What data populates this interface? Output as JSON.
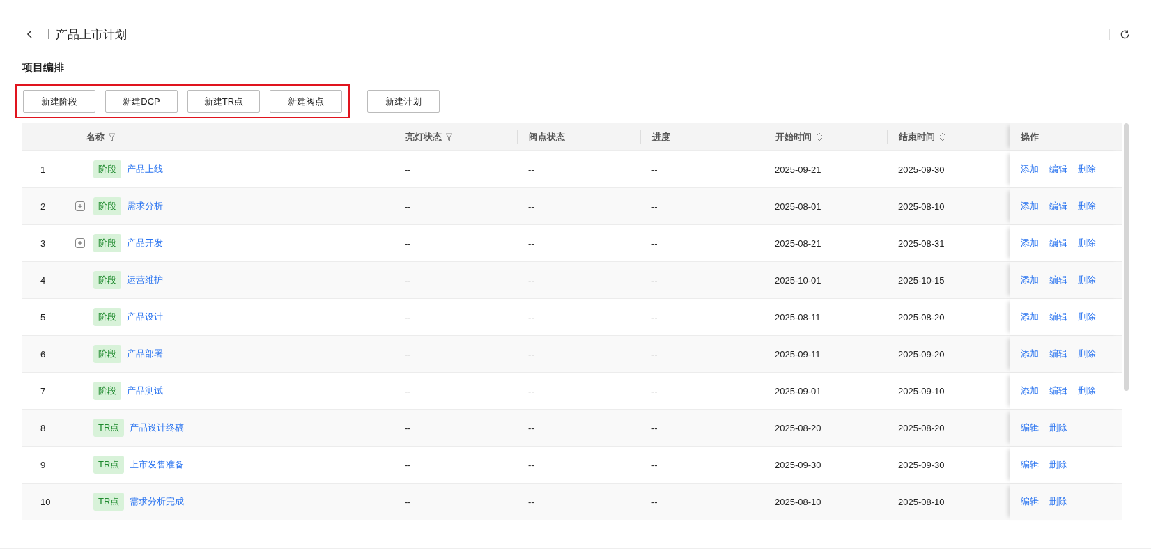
{
  "header": {
    "title": "产品上市计划"
  },
  "section_title": "项目编排",
  "button_groups": [
    {
      "highlighted": true,
      "buttons": [
        "新建阶段",
        "新建DCP",
        "新建TR点",
        "新建阀点"
      ]
    },
    {
      "highlighted": false,
      "buttons": [
        "新建计划"
      ]
    }
  ],
  "table": {
    "columns": [
      {},
      {
        "label": "名称"
      },
      {
        "label": "亮灯状态"
      },
      {
        "label": "阀点状态"
      },
      {
        "label": "进度"
      },
      {
        "label": "开始时间"
      },
      {
        "label": "结束时间"
      },
      {
        "label": "操作"
      }
    ],
    "rows": [
      {
        "index": "1",
        "expandable": false,
        "tag": "阶段",
        "name": "产品上线",
        "highlight": "--",
        "gate": "--",
        "progress": "--",
        "start": "2025-09-21",
        "end": "2025-09-30",
        "actions": [
          "添加",
          "编辑",
          "删除"
        ]
      },
      {
        "index": "2",
        "expandable": true,
        "tag": "阶段",
        "name": "需求分析",
        "highlight": "--",
        "gate": "--",
        "progress": "--",
        "start": "2025-08-01",
        "end": "2025-08-10",
        "actions": [
          "添加",
          "编辑",
          "删除"
        ]
      },
      {
        "index": "3",
        "expandable": true,
        "tag": "阶段",
        "name": "产品开发",
        "highlight": "--",
        "gate": "--",
        "progress": "--",
        "start": "2025-08-21",
        "end": "2025-08-31",
        "actions": [
          "添加",
          "编辑",
          "删除"
        ]
      },
      {
        "index": "4",
        "expandable": false,
        "tag": "阶段",
        "name": "运营维护",
        "highlight": "--",
        "gate": "--",
        "progress": "--",
        "start": "2025-10-01",
        "end": "2025-10-15",
        "actions": [
          "添加",
          "编辑",
          "删除"
        ]
      },
      {
        "index": "5",
        "expandable": false,
        "tag": "阶段",
        "name": "产品设计",
        "highlight": "--",
        "gate": "--",
        "progress": "--",
        "start": "2025-08-11",
        "end": "2025-08-20",
        "actions": [
          "添加",
          "编辑",
          "删除"
        ]
      },
      {
        "index": "6",
        "expandable": false,
        "tag": "阶段",
        "name": "产品部署",
        "highlight": "--",
        "gate": "--",
        "progress": "--",
        "start": "2025-09-11",
        "end": "2025-09-20",
        "actions": [
          "添加",
          "编辑",
          "删除"
        ]
      },
      {
        "index": "7",
        "expandable": false,
        "tag": "阶段",
        "name": "产品测试",
        "highlight": "--",
        "gate": "--",
        "progress": "--",
        "start": "2025-09-01",
        "end": "2025-09-10",
        "actions": [
          "添加",
          "编辑",
          "删除"
        ]
      },
      {
        "index": "8",
        "expandable": false,
        "tag": "TR点",
        "name": "产品设计终稿",
        "highlight": "--",
        "gate": "--",
        "progress": "--",
        "start": "2025-08-20",
        "end": "2025-08-20",
        "actions": [
          "编辑",
          "删除"
        ]
      },
      {
        "index": "9",
        "expandable": false,
        "tag": "TR点",
        "name": "上市发售准备",
        "highlight": "--",
        "gate": "--",
        "progress": "--",
        "start": "2025-09-30",
        "end": "2025-09-30",
        "actions": [
          "编辑",
          "删除"
        ]
      },
      {
        "index": "10",
        "expandable": false,
        "tag": "TR点",
        "name": "需求分析完成",
        "highlight": "--",
        "gate": "--",
        "progress": "--",
        "start": "2025-08-10",
        "end": "2025-08-10",
        "actions": [
          "编辑",
          "删除"
        ]
      }
    ]
  }
}
